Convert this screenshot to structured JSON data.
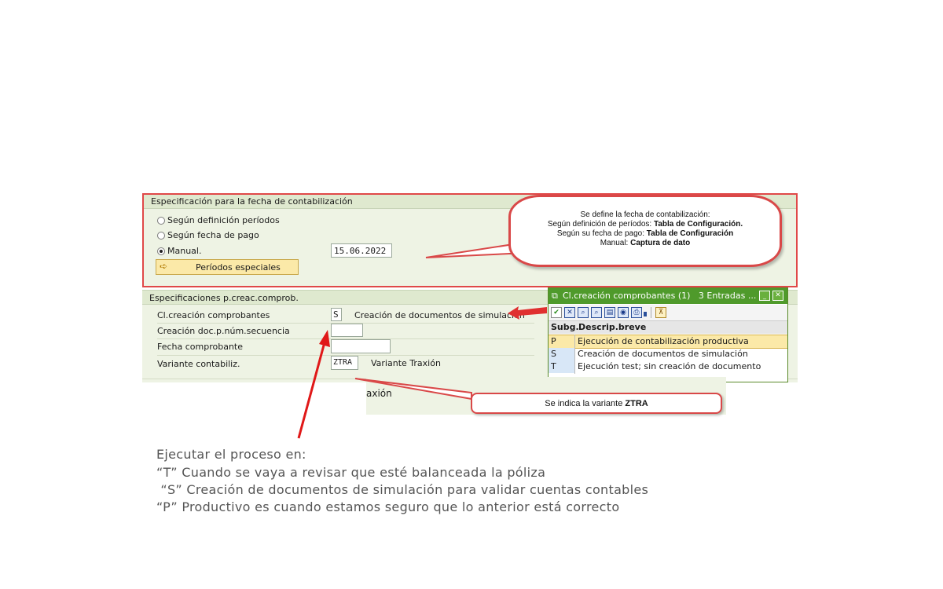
{
  "section1": {
    "title": "Especificación para la fecha de contabilización",
    "radio_periodos": "Según definición períodos",
    "radio_pago": "Según fecha de pago",
    "radio_manual": "Manual.",
    "date_value": "15.06.2022",
    "button_label": "Períodos especiales"
  },
  "callout1": {
    "line1": "Se define la fecha de contabilización:",
    "line2_a": "Según definición de períodos: ",
    "line2_b": "Tabla de Configuración.",
    "line3_a": "Según su fecha de pago: ",
    "line3_b": "Tabla de Configuración",
    "line4_a": "Manual: ",
    "line4_b": "Captura de dato"
  },
  "section2": {
    "title": "Especificaciones p.creac.comprob.",
    "rows": [
      {
        "label": "Cl.creación comprobantes",
        "value": "S",
        "desc": "Creación de documentos de simulación"
      },
      {
        "label": "Creación doc.p.núm.secuencia",
        "value": "",
        "desc": ""
      },
      {
        "label": "Fecha comprobante",
        "value": "",
        "desc": ""
      },
      {
        "label": "Variante contabiliz.",
        "value": "ZTRA",
        "desc": "Variante Traxión"
      }
    ],
    "partial_text": "axión"
  },
  "popup": {
    "title": "Cl.creación comprobantes (1)   3 Entradas ...",
    "col_subg": "Subg.",
    "col_desc": "Descrip.breve",
    "rows": [
      {
        "code": "P",
        "desc": "Ejecución de contabilización productiva"
      },
      {
        "code": "S",
        "desc": "Creación de documentos de simulación"
      },
      {
        "code": "T",
        "desc": "Ejecución test; sin creación de documento"
      }
    ]
  },
  "callout2": {
    "text_a": "Se indica la variante ",
    "text_b": "ZTRA"
  },
  "notes": [
    "Ejecutar el proceso en:",
    "“T” Cuando se vaya a revisar que esté balanceada la póliza",
    " “S” Creación de documentos de simulación para validar cuentas contables",
    "“P” Productivo es cuando estamos seguro que lo anterior está correcto"
  ],
  "colors": {
    "accent_red": "#e03030",
    "sap_panel": "#eef3e4",
    "popup_green": "#4f9a2b",
    "highlight": "#fbe9a8"
  }
}
